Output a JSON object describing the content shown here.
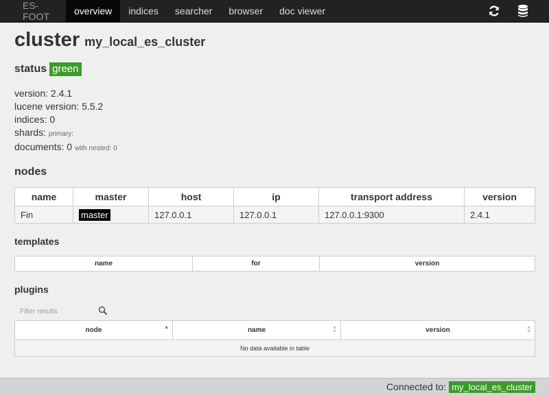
{
  "nav": {
    "brand": "ES-FOOT",
    "items": [
      "overview",
      "indices",
      "searcher",
      "browser",
      "doc viewer"
    ],
    "active": "overview",
    "icons": [
      "refresh-icon",
      "database-icon"
    ]
  },
  "title": {
    "main": "cluster",
    "name": "my_local_es_cluster"
  },
  "status": {
    "label": "status",
    "value": "green",
    "color": "#3c9b2b"
  },
  "info": {
    "version_label": "version:",
    "version": "2.4.1",
    "lucene_label": "lucene version:",
    "lucene": "5.5.2",
    "indices_label": "indices:",
    "indices": "0",
    "shards_label": "shards:",
    "shards_primary": "primary:",
    "documents_label": "documents:",
    "documents": "0",
    "nested": "with nested: 0"
  },
  "nodes": {
    "heading": "nodes",
    "columns": [
      "name",
      "master",
      "host",
      "ip",
      "transport address",
      "version"
    ],
    "rows": [
      {
        "name": "Fin",
        "master": "master",
        "host": "127.0.0.1",
        "ip": "127.0.0.1",
        "transport": "127.0.0.1:9300",
        "version": "2.4.1"
      }
    ]
  },
  "templates": {
    "heading": "templates",
    "columns": [
      "name",
      "for",
      "version"
    ]
  },
  "plugins": {
    "heading": "plugins",
    "filter_placeholder": "Filter results",
    "columns": [
      "node",
      "name",
      "version"
    ],
    "empty": "No data available in table"
  },
  "footer": {
    "label": "Connected to:",
    "cluster": "my_local_es_cluster"
  }
}
